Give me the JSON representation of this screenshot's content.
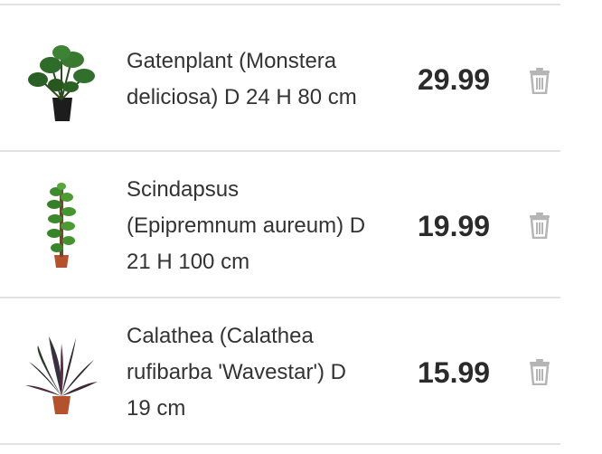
{
  "colors": {
    "divider": "#e2e2e2",
    "text": "#333333",
    "price": "#2b2b2b",
    "trash_icon": "#b5b5b5"
  },
  "cart": {
    "items": [
      {
        "title_lines": [
          "Gatenplant (Monstera",
          "deliciosa) D 24 H 80 cm"
        ],
        "price": "29.99",
        "image_icon": "monstera-plant-icon",
        "remove_icon": "trash-icon"
      },
      {
        "title_lines": [
          "Scindapsus",
          "(Epipremnum aureum) D",
          "21 H 100 cm"
        ],
        "price": "19.99",
        "image_icon": "scindapsus-plant-icon",
        "remove_icon": "trash-icon"
      },
      {
        "title_lines": [
          "Calathea (Calathea",
          "rufibarba 'Wavestar') D",
          "19 cm"
        ],
        "price": "15.99",
        "image_icon": "calathea-plant-icon",
        "remove_icon": "trash-icon"
      }
    ]
  }
}
